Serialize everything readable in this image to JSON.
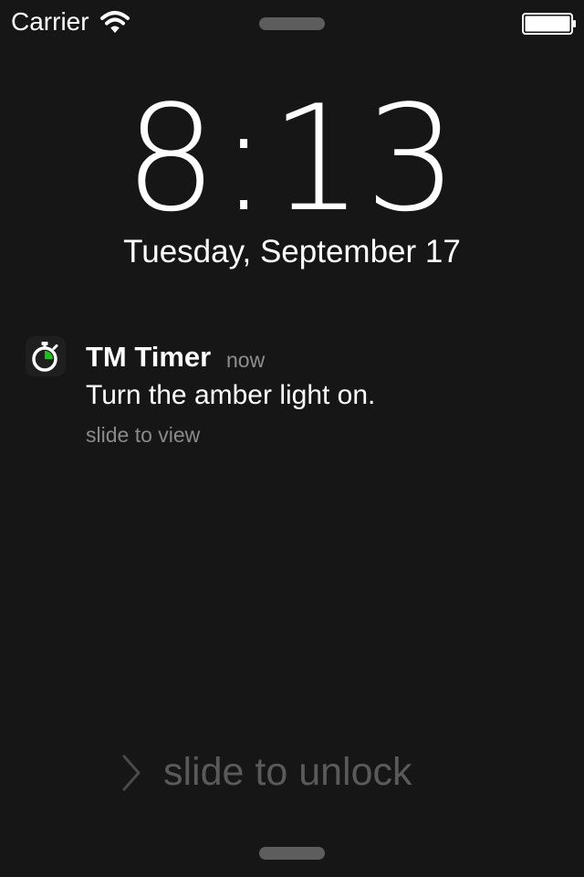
{
  "status_bar": {
    "carrier": "Carrier",
    "wifi_icon": "wifi-icon",
    "battery_icon": "battery-icon"
  },
  "lock_screen": {
    "time": "8:13",
    "date": "Tuesday, September 17",
    "unlock_label": "slide to unlock",
    "unlock_icon": "chevron-right-icon"
  },
  "notification": {
    "app_name": "TM Timer",
    "time": "now",
    "message": "Turn the amber light on.",
    "hint": "slide to view",
    "icon": "stopwatch-icon",
    "accent_color": "#19c419"
  },
  "colors": {
    "background": "#161616",
    "secondary_text": "#8e8e8e",
    "unlock_text": "#5a5a5a"
  }
}
